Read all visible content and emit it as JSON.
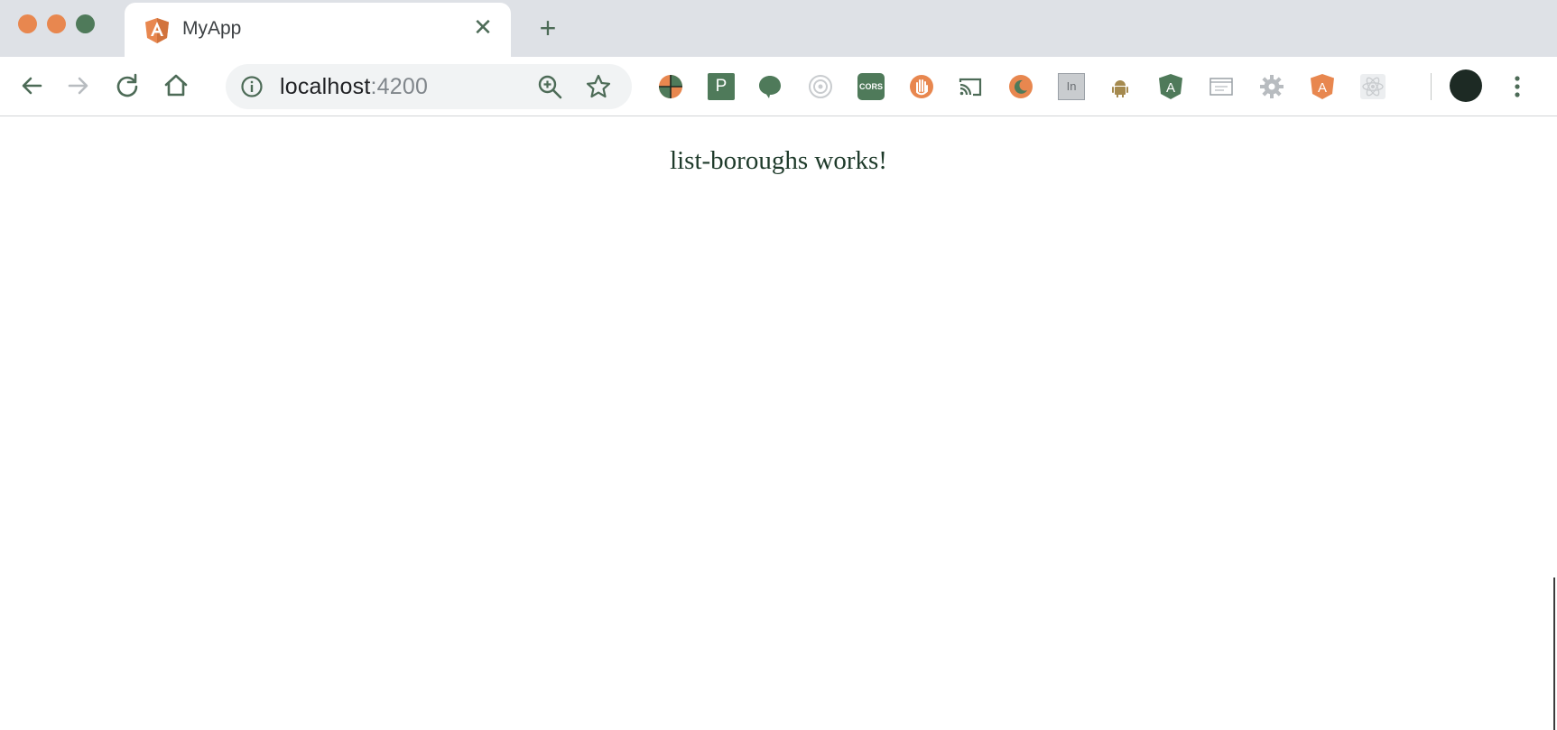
{
  "window": {
    "traffic_lights": [
      {
        "name": "close",
        "color": "#e8874f"
      },
      {
        "name": "minimize",
        "color": "#e8874f"
      },
      {
        "name": "maximize",
        "color": "#4f7a5a"
      }
    ]
  },
  "tab": {
    "title": "MyApp",
    "favicon": "angular-icon",
    "close_icon": "close-icon"
  },
  "new_tab_icon": "plus-icon",
  "toolbar": {
    "back_icon": "back-arrow-icon",
    "forward_icon": "forward-arrow-icon",
    "reload_icon": "reload-icon",
    "home_icon": "home-icon"
  },
  "omnibox": {
    "host": "localhost",
    "port": ":4200",
    "info_icon": "info-icon",
    "zoom_icon": "zoom-in-icon",
    "bookmark_icon": "star-icon"
  },
  "extensions": [
    {
      "name": "color-wheel-extension-icon"
    },
    {
      "name": "p-extension-icon",
      "label": "P"
    },
    {
      "name": "speech-bubble-extension-icon"
    },
    {
      "name": "target-extension-icon"
    },
    {
      "name": "cors-extension-icon",
      "label": "CORS"
    },
    {
      "name": "hand-extension-icon"
    },
    {
      "name": "cast-icon"
    },
    {
      "name": "moon-extension-icon"
    },
    {
      "name": "in-extension-icon",
      "label": "In"
    },
    {
      "name": "android-extension-icon"
    },
    {
      "name": "angular-extension-icon",
      "label": "A"
    },
    {
      "name": "window-extension-icon"
    },
    {
      "name": "gear-extension-icon"
    },
    {
      "name": "angular-orange-extension-icon",
      "label": "A"
    },
    {
      "name": "react-extension-icon"
    }
  ],
  "colors": {
    "accent_green": "#4d6b57",
    "accent_orange": "#e8874f",
    "tab_strip": "#dee1e6"
  },
  "page": {
    "message": "list-boroughs works!"
  }
}
